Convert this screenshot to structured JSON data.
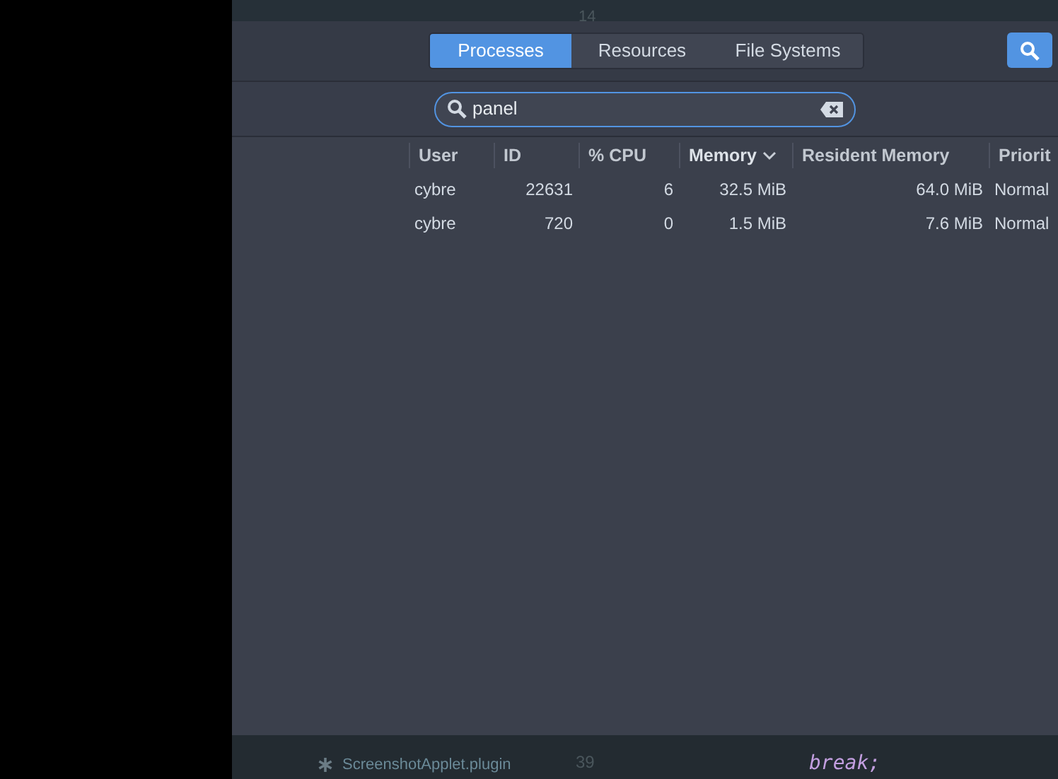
{
  "background_editor": {
    "top_line_number": "14",
    "bottom_file": "ScreenshotApplet.plugin",
    "bottom_line_number": "39",
    "bottom_code": "break;"
  },
  "tabs": [
    {
      "label": "Processes",
      "selected": true
    },
    {
      "label": "Resources",
      "selected": false
    },
    {
      "label": "File Systems",
      "selected": false
    }
  ],
  "search": {
    "value": "panel"
  },
  "table": {
    "columns": [
      {
        "label": "User",
        "sorted": false
      },
      {
        "label": "ID",
        "sorted": false
      },
      {
        "label": "% CPU",
        "sorted": false
      },
      {
        "label": "Memory",
        "sorted": true
      },
      {
        "label": "Resident Memory",
        "sorted": false
      },
      {
        "label": "Priorit",
        "sorted": false
      }
    ],
    "rows": [
      [
        "cybre",
        "22631",
        "6",
        "32.5 MiB",
        "64.0 MiB",
        "Normal"
      ],
      [
        "cybre",
        "720",
        "0",
        "1.5 MiB",
        "7.6 MiB",
        "Normal"
      ]
    ]
  }
}
